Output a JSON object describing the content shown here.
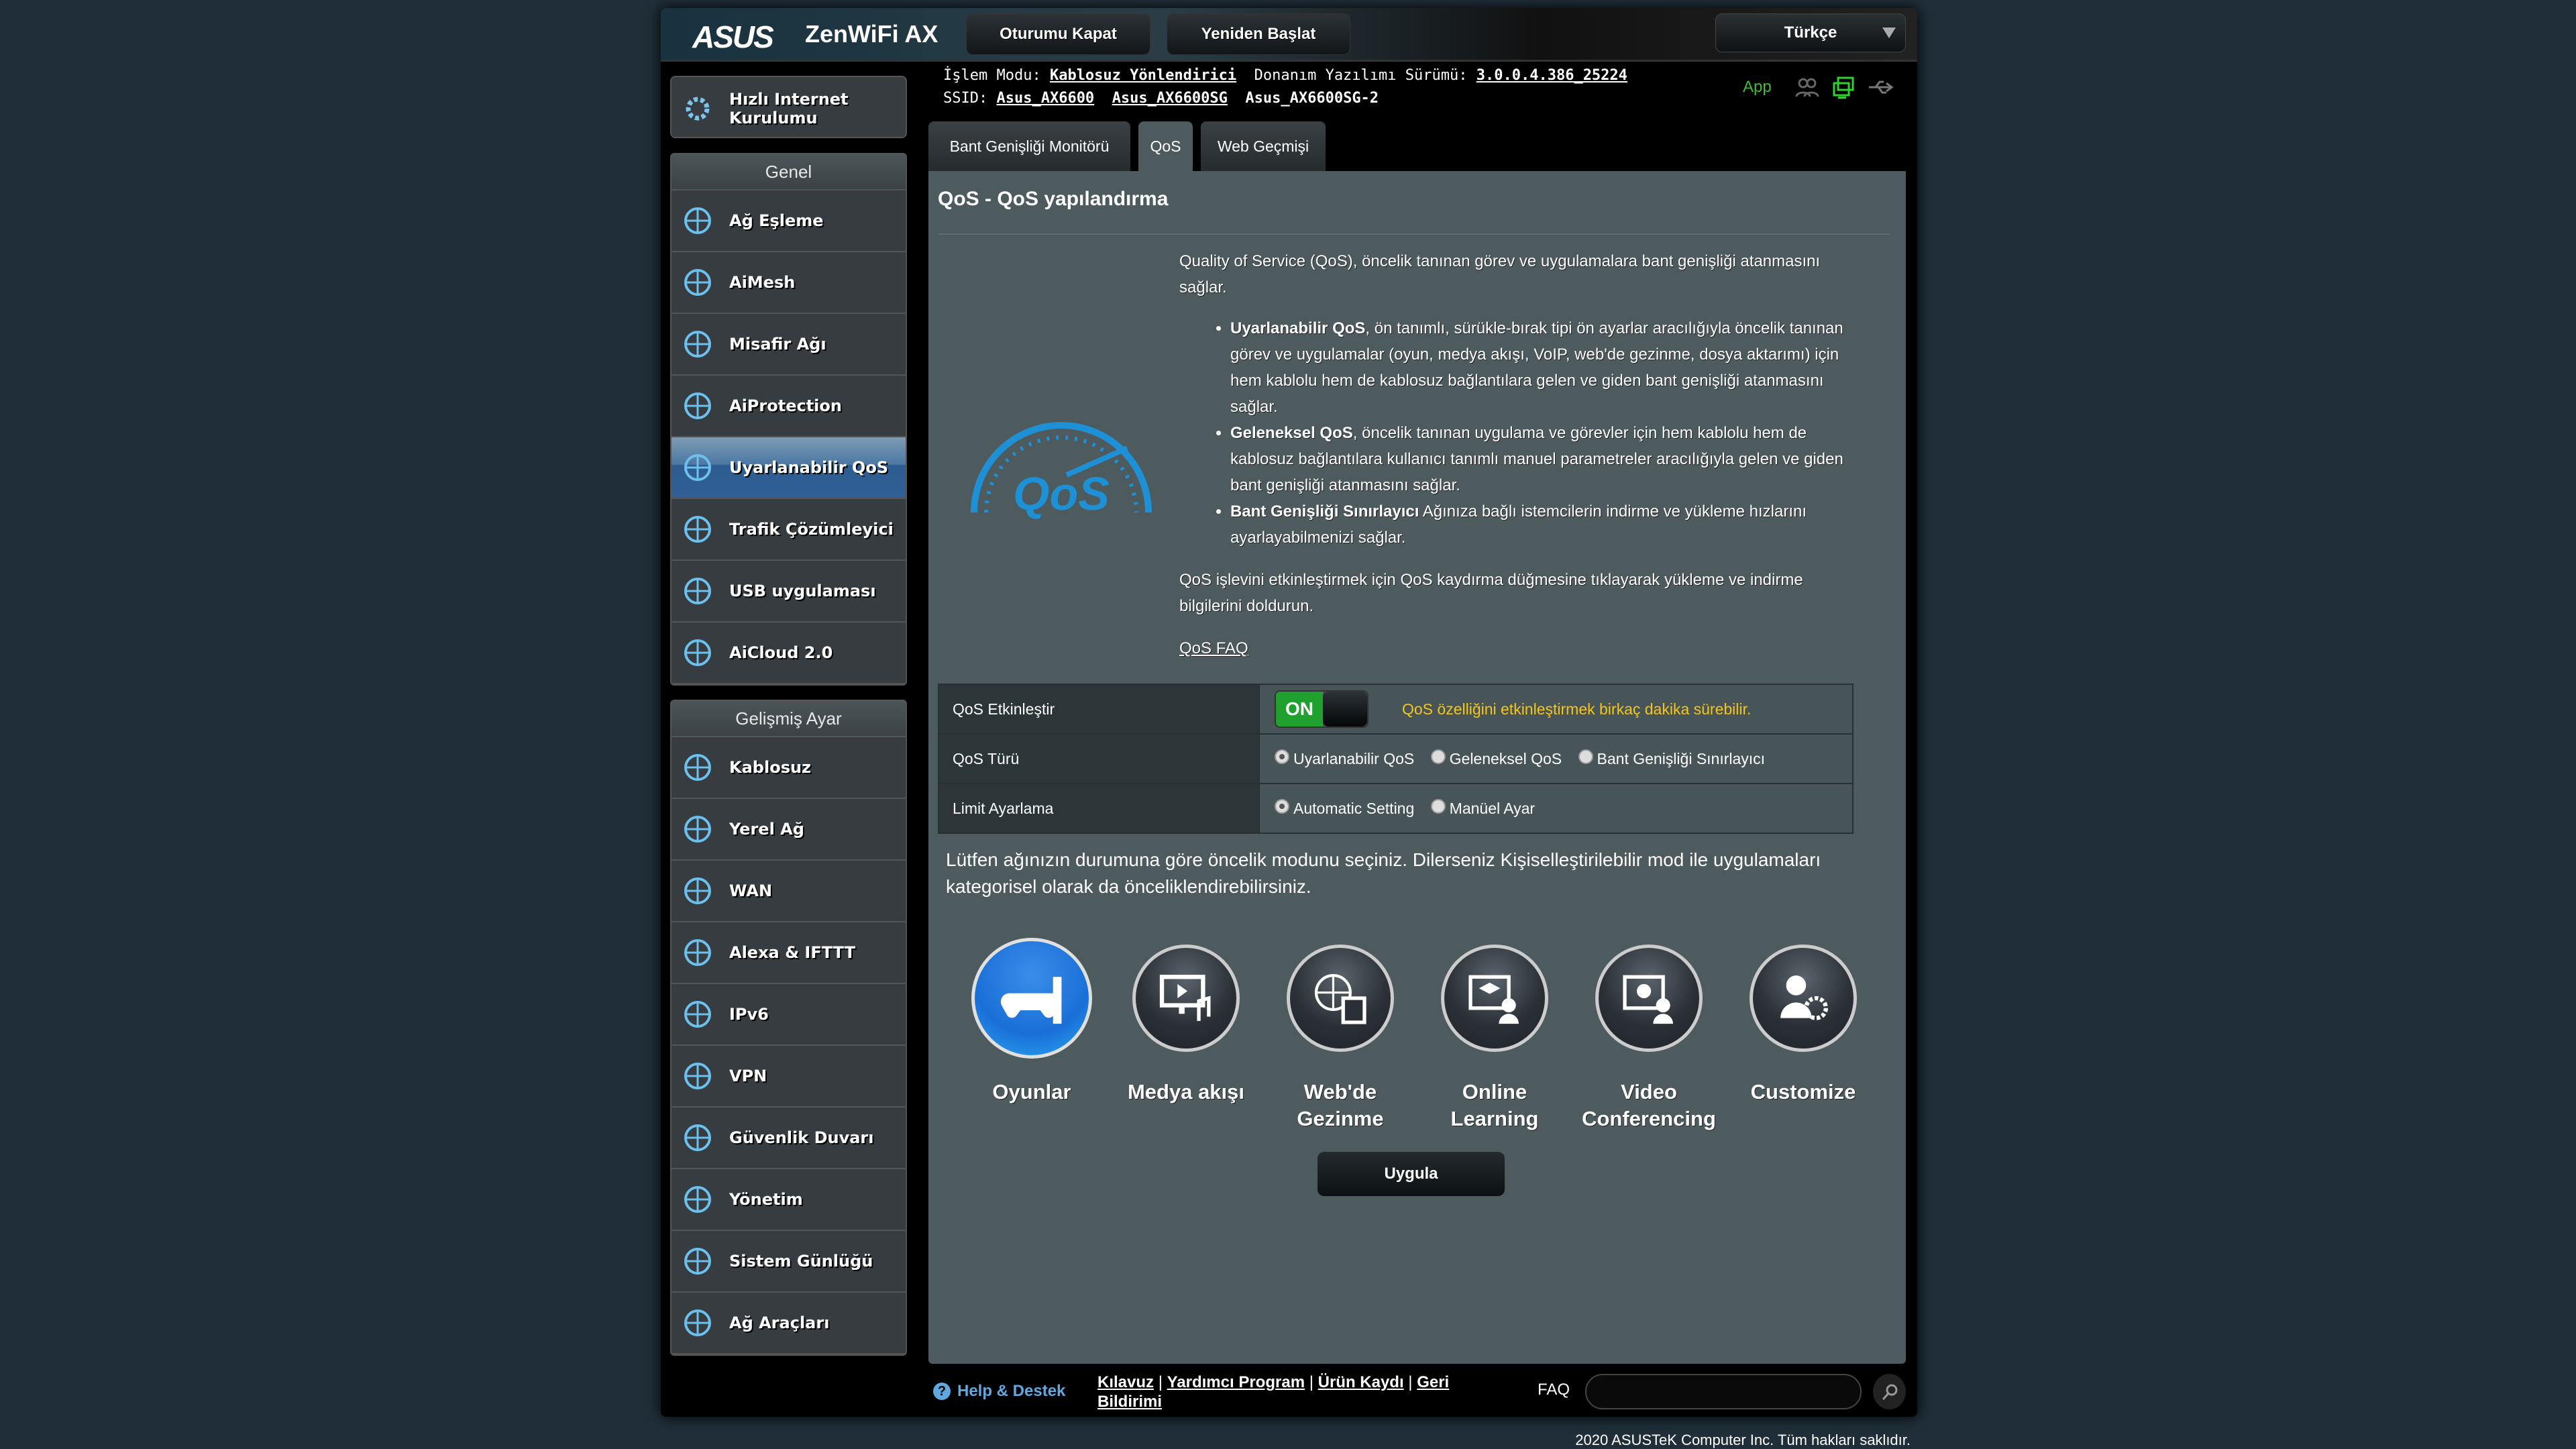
{
  "header": {
    "brand": "ASUS",
    "model": "ZenWiFi AX",
    "logout": "Oturumu Kapat",
    "reboot": "Yeniden Başlat",
    "language": "Türkçe"
  },
  "quick_setup": "Hızlı Internet Kurulumu",
  "sidebar": {
    "general_title": "Genel",
    "general": [
      {
        "label": "Ağ Eşleme",
        "icon": "network-map-icon"
      },
      {
        "label": "AiMesh",
        "icon": "aimesh-icon"
      },
      {
        "label": "Misafir Ağı",
        "icon": "guest-network-icon"
      },
      {
        "label": "AiProtection",
        "icon": "shield-lock-icon"
      },
      {
        "label": "Uyarlanabilir QoS",
        "icon": "speedometer-icon",
        "active": true
      },
      {
        "label": "Trafik Çözümleyici",
        "icon": "traffic-analyzer-icon"
      },
      {
        "label": "USB uygulaması",
        "icon": "usb-icon"
      },
      {
        "label": "AiCloud 2.0",
        "icon": "cloud-icon"
      }
    ],
    "advanced_title": "Gelişmiş Ayar",
    "advanced": [
      {
        "label": "Kablosuz",
        "icon": "wireless-icon"
      },
      {
        "label": "Yerel Ağ",
        "icon": "lan-icon"
      },
      {
        "label": "WAN",
        "icon": "globe-icon"
      },
      {
        "label": "Alexa & IFTTT",
        "icon": "alexa-icon"
      },
      {
        "label": "IPv6",
        "icon": "ipv6-icon"
      },
      {
        "label": "VPN",
        "icon": "vpn-icon"
      },
      {
        "label": "Güvenlik Duvarı",
        "icon": "firewall-icon"
      },
      {
        "label": "Yönetim",
        "icon": "admin-icon"
      },
      {
        "label": "Sistem Günlüğü",
        "icon": "log-icon"
      },
      {
        "label": "Ağ Araçları",
        "icon": "tools-icon"
      }
    ]
  },
  "status": {
    "mode_label": "İşlem Modu:",
    "mode": "Kablosuz Yönlendirici",
    "fw_label": "Donanım Yazılımı Sürümü:",
    "fw": "3.0.0.4.386_25224",
    "ssid_label": "SSID:",
    "ssids": [
      "Asus_AX6600",
      "Asus_AX6600SG",
      "Asus_AX6600SG-2"
    ],
    "app": "App"
  },
  "tabs": [
    "Bant Genişliği Monitörü",
    "QoS",
    "Web Geçmişi"
  ],
  "page": {
    "title": "QoS - QoS yapılandırma",
    "intro": "Quality of Service (QoS), öncelik tanınan görev ve uygulamalara bant genişliği atanmasını sağlar.",
    "bullets": [
      {
        "bold": "Uyarlanabilir QoS",
        "text": ", ön tanımlı, sürükle-bırak tipi ön ayarlar aracılığıyla öncelik tanınan görev ve uygulamalar (oyun, medya akışı, VoIP, web'de gezinme, dosya aktarımı) için hem kablolu hem de kablosuz bağlantılara gelen ve giden bant genişliği atanmasını sağlar."
      },
      {
        "bold": "Geleneksel QoS",
        "text": ", öncelik tanınan uygulama ve görevler için hem kablolu hem de kablosuz bağlantılara kullanıcı tanımlı manuel parametreler aracılığıyla gelen ve giden bant genişliği atanmasını sağlar."
      },
      {
        "bold": "Bant Genişliği Sınırlayıcı",
        "text": " Ağınıza bağlı istemcilerin indirme ve yükleme hızlarını ayarlayabilmenizi sağlar."
      }
    ],
    "enable_hint": "QoS işlevini etkinleştirmek için QoS kaydırma düğmesine tıklayarak yükleme ve indirme bilgilerini doldurun.",
    "faq_link": "QoS FAQ",
    "logo_text": "QoS"
  },
  "settings": {
    "enable_label": "QoS Etkinleştir",
    "enable_state": "ON",
    "enable_warning": "QoS özelliğini etkinleştirmek birkaç dakika sürebilir.",
    "type_label": "QoS Türü",
    "type_options": [
      "Uyarlanabilir QoS",
      "Geleneksel QoS",
      "Bant Genişliği Sınırlayıcı"
    ],
    "type_selected": "Uyarlanabilir QoS",
    "limit_label": "Limit Ayarlama",
    "limit_options": [
      "Automatic Setting",
      "Manüel Ayar"
    ],
    "limit_selected": "Automatic Setting"
  },
  "priority_hint": "Lütfen ağınızın durumuna göre öncelik modunu seçiniz. Dilerseniz Kişiselleştirilebilir mod ile uygulamaları kategorisel olarak da önceliklendirebilirsiniz.",
  "modes": [
    {
      "label": "Oyunlar",
      "icon": "gamepad-icon",
      "selected": true
    },
    {
      "label": "Medya akışı",
      "icon": "media-streaming-icon"
    },
    {
      "label": "Web'de Gezinme",
      "icon": "web-browsing-icon"
    },
    {
      "label": "Online Learning",
      "icon": "online-learning-icon"
    },
    {
      "label": "Video Conferencing",
      "icon": "video-conferencing-icon"
    },
    {
      "label": "Customize",
      "icon": "customize-icon"
    }
  ],
  "apply": "Uygula",
  "footer": {
    "help": "Help & Destek",
    "links": [
      "Kılavuz",
      "Yardımcı Program",
      "Ürün Kaydı",
      "Geri Bildirimi"
    ],
    "faq": "FAQ",
    "search_placeholder": "",
    "copyright": "2020 ASUSTeK Computer Inc. Tüm hakları saklıdır."
  },
  "colors": {
    "accent": "#2f5f94",
    "on": "#1fa02f",
    "warning": "#f5c518",
    "panel": "#4d5a5e"
  }
}
